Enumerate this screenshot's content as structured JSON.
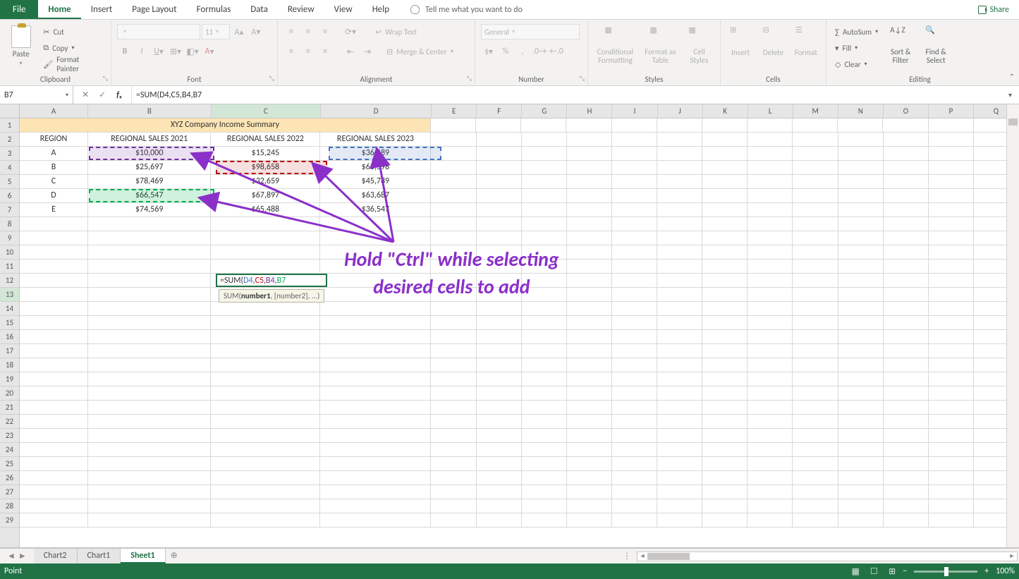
{
  "tabs": {
    "file": "File",
    "home": "Home",
    "insert": "Insert",
    "pagelayout": "Page Layout",
    "formulas": "Formulas",
    "data": "Data",
    "review": "Review",
    "view": "View",
    "help": "Help",
    "tellme": "Tell me what you want to do",
    "share": "Share"
  },
  "ribbon": {
    "clipboard": {
      "paste": "Paste",
      "cut": "Cut",
      "copy": "Copy",
      "fmtpainter": "Format Painter",
      "label": "Clipboard"
    },
    "font": {
      "size": "11",
      "label": "Font"
    },
    "alignment": {
      "wrap": "Wrap Text",
      "merge": "Merge & Center",
      "label": "Alignment"
    },
    "number": {
      "general": "General",
      "label": "Number"
    },
    "styles": {
      "cond": "Conditional Formatting",
      "tbl": "Format as Table",
      "cell": "Cell Styles",
      "label": "Styles"
    },
    "cells": {
      "insert": "Insert",
      "delete": "Delete",
      "format": "Format",
      "label": "Cells"
    },
    "editing": {
      "autosum": "AutoSum",
      "fill": "Fill",
      "clear": "Clear",
      "sort": "Sort & Filter",
      "find": "Find & Select",
      "label": "Editing"
    }
  },
  "namebox": "B7",
  "formula": "=SUM(D4,C5,B4,B7",
  "cols": [
    "A",
    "B",
    "C",
    "D",
    "E",
    "F",
    "G",
    "H",
    "I",
    "J",
    "K",
    "L",
    "M",
    "N",
    "O",
    "P",
    "Q"
  ],
  "rows": [
    1,
    2,
    3,
    4,
    5,
    6,
    7,
    8,
    9,
    10,
    11,
    12,
    13,
    14,
    15,
    16,
    17,
    18,
    19,
    20,
    21,
    22,
    23,
    24,
    25,
    26,
    27,
    28,
    29
  ],
  "title_row": "XYZ Company Income Summary",
  "headers": [
    "REGION",
    "REGIONAL SALES 2021",
    "REGIONAL SALES 2022",
    "REGIONAL SALES 2023"
  ],
  "data": [
    [
      "A",
      "$10,000",
      "$15,245",
      "$36,589"
    ],
    [
      "B",
      "$25,697",
      "$98,658",
      "$63,598"
    ],
    [
      "C",
      "$78,469",
      "$32,659",
      "$45,789"
    ],
    [
      "D",
      "$66,547",
      "$67,897",
      "$63,687"
    ],
    [
      "E",
      "$74,569",
      "$65,488",
      "$36,547"
    ]
  ],
  "editing_cell": "=SUM(D4,C5,B4,B7",
  "fn_tooltip": {
    "name": "SUM",
    "sig": "(number1, [number2], ...)",
    "bold": "number1"
  },
  "annotation": {
    "line1": "Hold \"Ctrl\" while selecting",
    "line2": "desired cells to add"
  },
  "sheets": {
    "nav": [
      "◄",
      "►"
    ],
    "tabs": [
      "Chart2",
      "Chart1",
      "Sheet1"
    ],
    "active": 2
  },
  "status": {
    "mode": "Point",
    "zoom": "100%"
  }
}
